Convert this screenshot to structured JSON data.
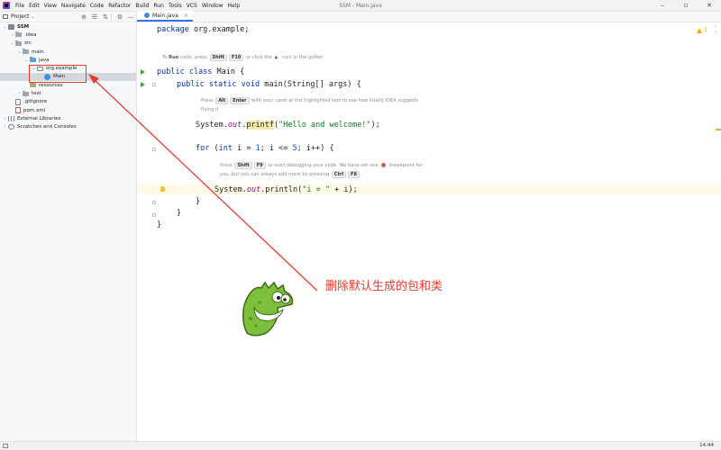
{
  "window": {
    "title": "SSM - Main.java",
    "controls": [
      "–",
      "▫",
      "✕"
    ]
  },
  "menu": [
    "File",
    "Edit",
    "View",
    "Navigate",
    "Code",
    "Refactor",
    "Build",
    "Run",
    "Tools",
    "VCS",
    "Window",
    "Help"
  ],
  "project_panel": {
    "title": "Project",
    "caret": "⌄",
    "tools": [
      "⊕",
      "☰",
      "⇅",
      "⚙",
      "—"
    ],
    "tree": [
      {
        "label": "SSM",
        "depth": 0,
        "arrow": "⌄",
        "icon": "module-icon",
        "bold": true
      },
      {
        "label": ".idea",
        "depth": 1,
        "arrow": "›",
        "icon": "folder-icon"
      },
      {
        "label": "src",
        "depth": 1,
        "arrow": "⌄",
        "icon": "folder-icon"
      },
      {
        "label": "main",
        "depth": 2,
        "arrow": "⌄",
        "icon": "folder-icon"
      },
      {
        "label": "java",
        "depth": 3,
        "arrow": "⌄",
        "icon": "source-folder-icon"
      },
      {
        "label": "org.example",
        "depth": 4,
        "arrow": "⌄",
        "icon": "package-icon"
      },
      {
        "label": "Main",
        "depth": 5,
        "arrow": "",
        "icon": "class-icon",
        "selected": true
      },
      {
        "label": "resources",
        "depth": 3,
        "arrow": "",
        "icon": "resources-folder-icon"
      },
      {
        "label": "test",
        "depth": 2,
        "arrow": "›",
        "icon": "folder-icon"
      },
      {
        "label": ".gitignore",
        "depth": 1,
        "arrow": "",
        "icon": "file-icon"
      },
      {
        "label": "pom.xml",
        "depth": 1,
        "arrow": "",
        "icon": "pom-file-icon"
      },
      {
        "label": "External Libraries",
        "depth": 0,
        "arrow": "›",
        "icon": "library-icon"
      },
      {
        "label": "Scratches and Consoles",
        "depth": 0,
        "arrow": "›",
        "icon": "scratch-icon"
      }
    ]
  },
  "editor": {
    "tab_label": "Main.java",
    "tab_close": "×",
    "warning_count": "1",
    "hints": {
      "run": {
        "a": "To ",
        "b": "Run",
        "c": " code, press ",
        "k1": "Shift",
        "k2": "F10",
        "d": " or click the ",
        "e": " icon in the gutter."
      },
      "alt_enter": {
        "a": "Press ",
        "k1": "Alt",
        "k2": "Enter",
        "b": " with your caret at the highlighted text to see how IntelliJ IDEA suggests",
        "c": "fixing it."
      },
      "debug": {
        "a": "Press ",
        "k1": "Shift",
        "k2": "F9",
        "b": " to start debugging your code. We have set one ",
        "c": " breakpoint for",
        "d": "you, but you can always add more by pressing ",
        "k3": "Ctrl",
        "k4": "F8",
        "e": "."
      }
    }
  },
  "annotation": {
    "text": "删除默认生成的包和类",
    "color": "#e53b2f"
  },
  "status_bar": {
    "position": "14:44"
  },
  "colors": {
    "keyword": "#0033b3",
    "number": "#1750eb",
    "string": "#067d17",
    "field": "#871094",
    "run_icon": "#4a9e52",
    "accent": "#3574f0"
  }
}
